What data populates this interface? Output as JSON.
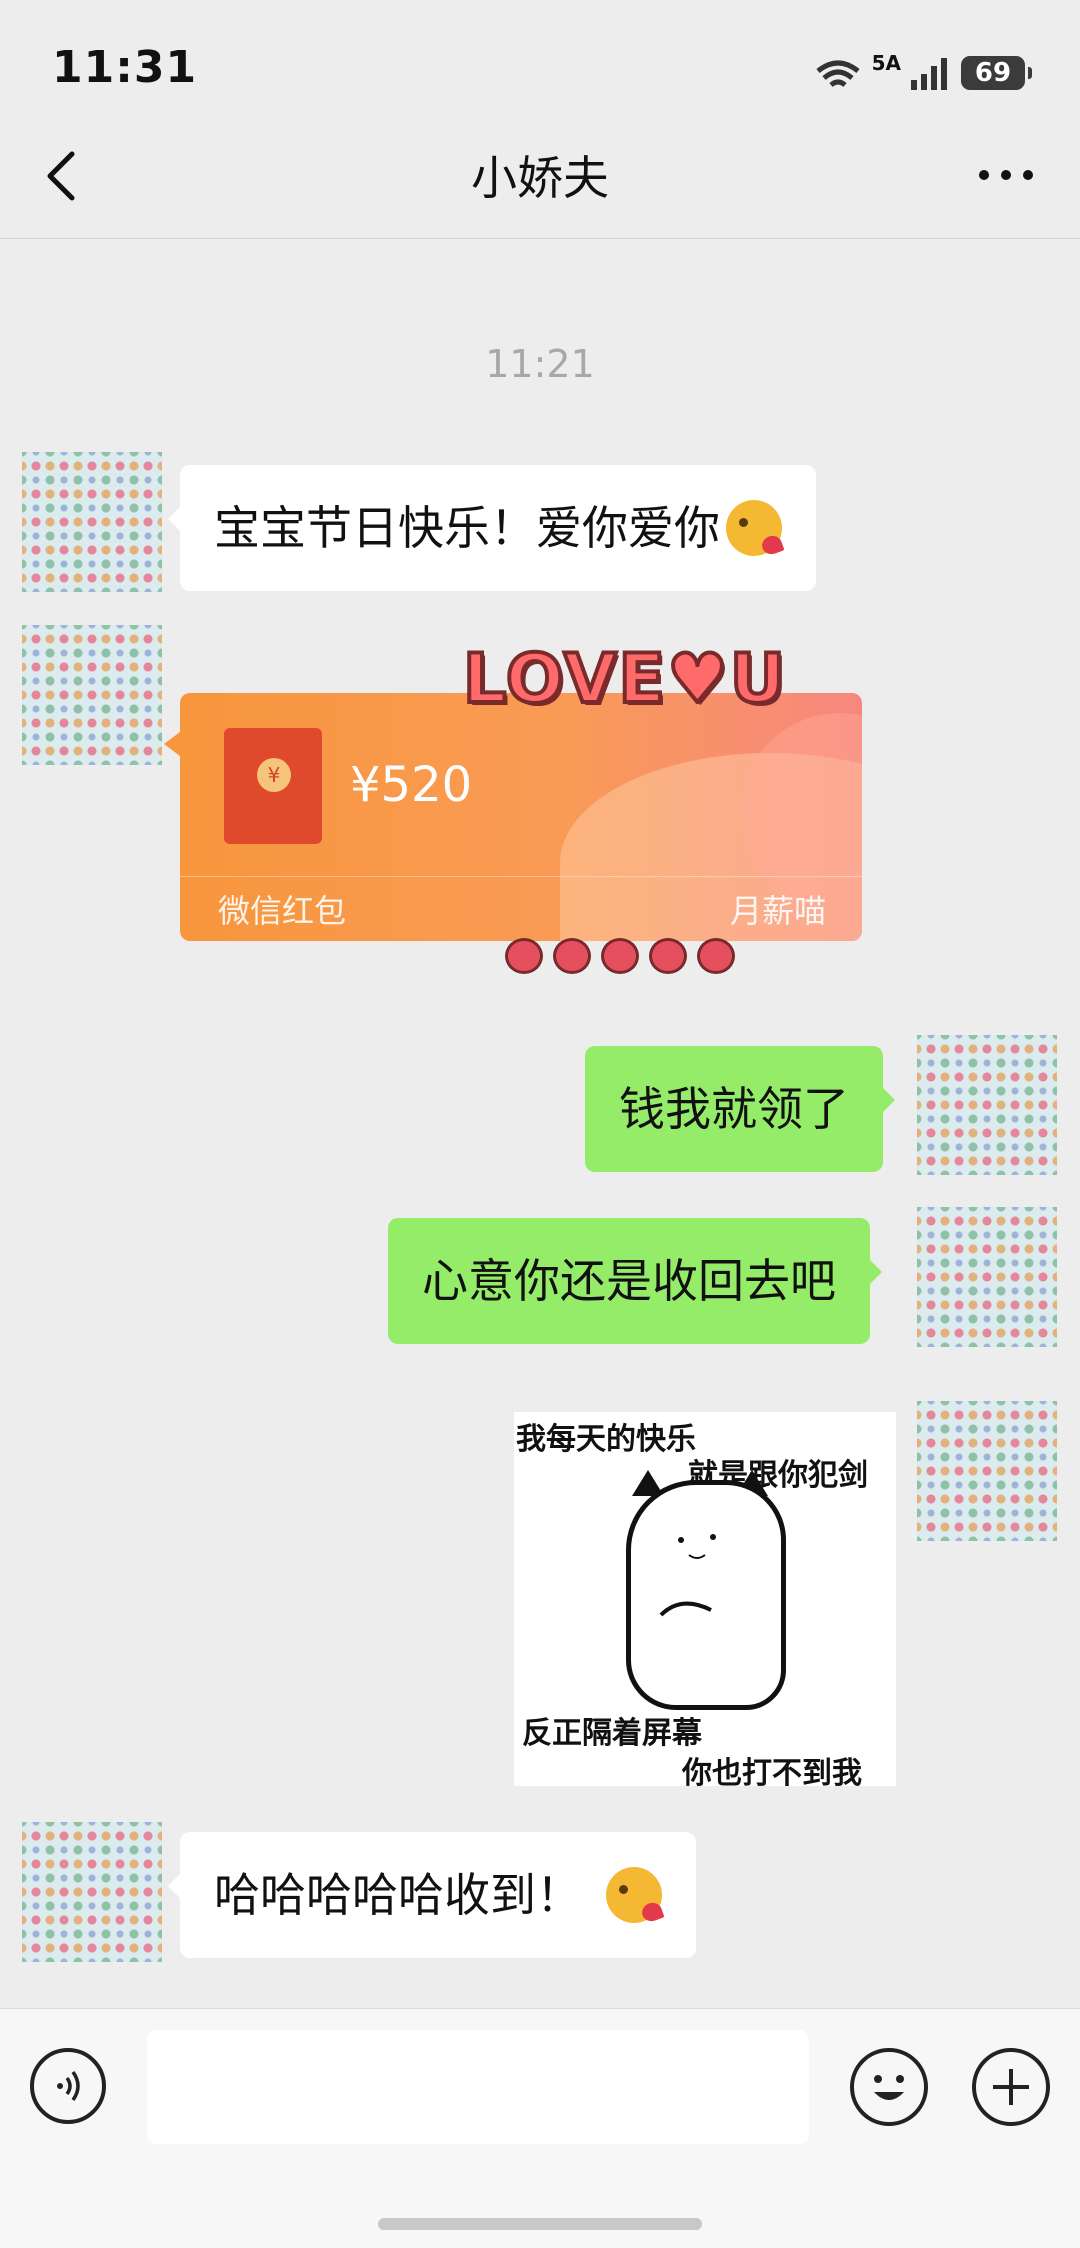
{
  "status_bar": {
    "time": "11:31",
    "network": "5A",
    "battery": "69"
  },
  "header": {
    "title": "小娇夫"
  },
  "timestamp": "11:21",
  "messages": {
    "m1": "宝宝节日快乐！爱你爱你",
    "red_packet": {
      "amount": "¥520",
      "label": "微信红包",
      "brand": "月薪喵",
      "coin": "¥",
      "overlay": "LOVE♥U"
    },
    "m3": "钱我就领了",
    "m4": "心意你还是收回去吧",
    "sticker": {
      "line1": "我每天的快乐",
      "line2": "就是跟你犯剑",
      "line3": "反正隔着屏幕",
      "line4": "你也打不到我"
    },
    "m6": "哈哈哈哈哈收到！"
  },
  "colors": {
    "outgoing_bubble": "#95ec69",
    "incoming_bubble": "#ffffff",
    "background": "#ededed",
    "red_packet": "#f8963d"
  },
  "icons": [
    "back-icon",
    "more-icon",
    "wifi-icon",
    "signal-icon",
    "battery-icon",
    "voice-icon",
    "emoji-icon",
    "plus-icon"
  ]
}
